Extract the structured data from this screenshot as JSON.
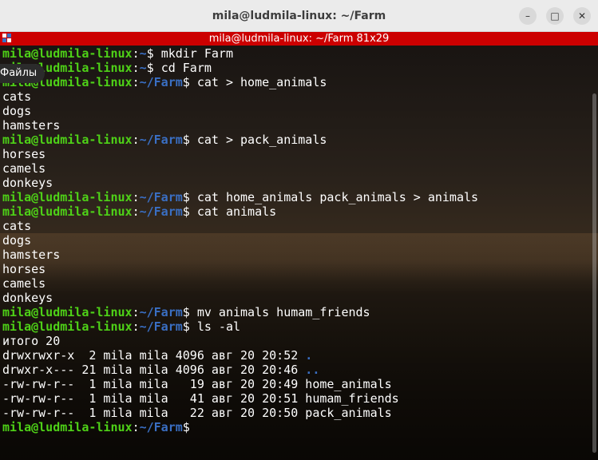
{
  "window": {
    "title": "mila@ludmila-linux: ~/Farm",
    "minimize_glyph": "–",
    "maximize_glyph": "□",
    "close_glyph": "✕",
    "status_bar_title": "mila@ludmila-linux: ~/Farm 81x29"
  },
  "tooltip": {
    "label": "Файлы"
  },
  "colors": {
    "user_host": "#4ed117",
    "path": "#3a6fc4",
    "status_bar": "#cc0000",
    "text": "#ffffff"
  },
  "terminal": {
    "lines": [
      {
        "user": "mila@ludmila-linux",
        "path": "~",
        "cmd": "mkdir Farm"
      },
      {
        "user": "mila@ludmila-linux",
        "path": "~",
        "cmd": "cd Farm"
      },
      {
        "user": "mila@ludmila-linux",
        "path": "~/Farm",
        "cmd": "cat > home_animals"
      },
      {
        "text": "cats"
      },
      {
        "text": "dogs"
      },
      {
        "text": "hamsters"
      },
      {
        "user": "mila@ludmila-linux",
        "path": "~/Farm",
        "cmd": "cat > pack_animals"
      },
      {
        "text": "horses"
      },
      {
        "text": "camels"
      },
      {
        "text": "donkeys"
      },
      {
        "user": "mila@ludmila-linux",
        "path": "~/Farm",
        "cmd": "cat home_animals pack_animals > animals"
      },
      {
        "user": "mila@ludmila-linux",
        "path": "~/Farm",
        "cmd": "cat animals"
      },
      {
        "text": "cats"
      },
      {
        "text": "dogs"
      },
      {
        "text": "hamsters"
      },
      {
        "text": "horses"
      },
      {
        "text": "camels"
      },
      {
        "text": "donkeys"
      },
      {
        "user": "mila@ludmila-linux",
        "path": "~/Farm",
        "cmd": "mv animals humam_friends"
      },
      {
        "user": "mila@ludmila-linux",
        "path": "~/Farm",
        "cmd": "ls -al"
      },
      {
        "text": "итого 20"
      },
      {
        "text": "drwxrwxr-x  2 mila mila 4096 авг 20 20:52 ",
        "dir": "."
      },
      {
        "text": "drwxr-x--- 21 mila mila 4096 авг 20 20:46 ",
        "dir": ".."
      },
      {
        "text": "-rw-rw-r--  1 mila mila   19 авг 20 20:49 home_animals"
      },
      {
        "text": "-rw-rw-r--  1 mila mila   41 авг 20 20:51 humam_friends"
      },
      {
        "text": "-rw-rw-r--  1 mila mila   22 авг 20 20:50 pack_animals"
      },
      {
        "user": "mila@ludmila-linux",
        "path": "~/Farm",
        "cmd": ""
      }
    ]
  }
}
